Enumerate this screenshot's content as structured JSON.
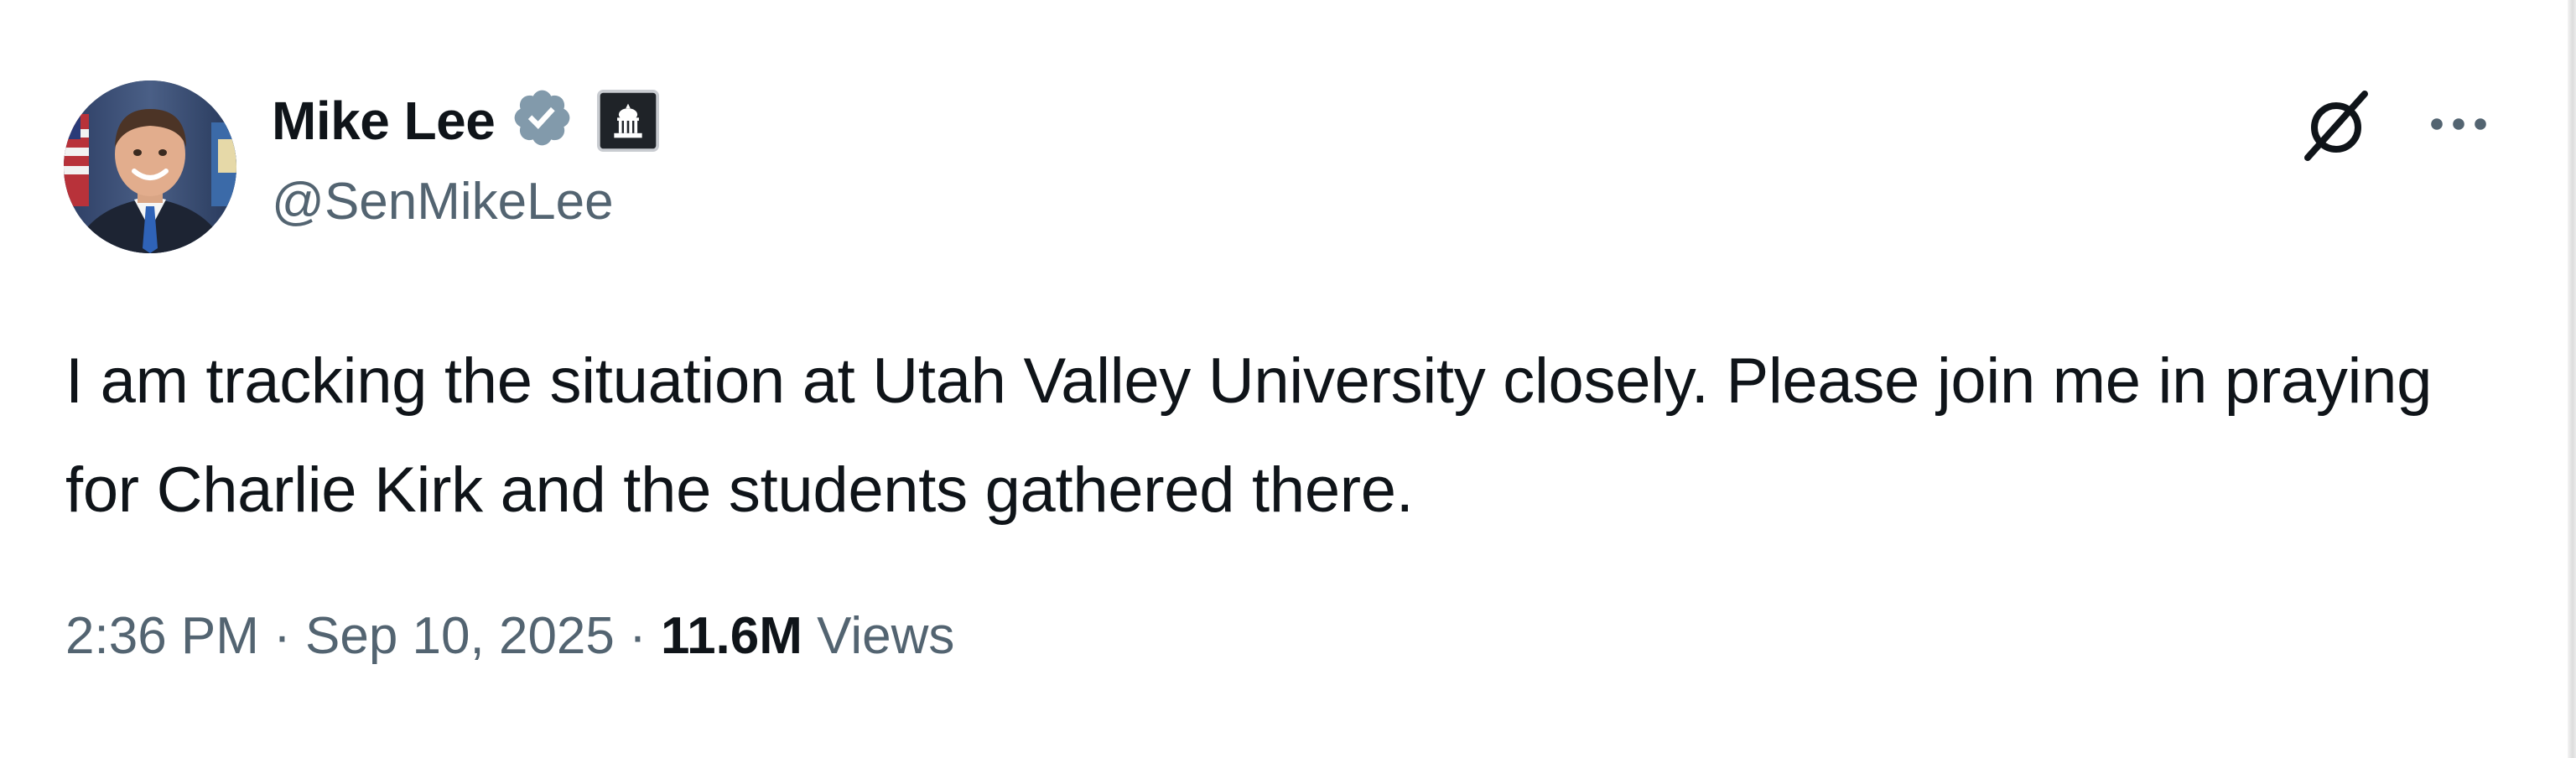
{
  "author": {
    "name": "Mike Lee",
    "handle": "@SenMikeLee",
    "verified_icon": "verified-badge-icon",
    "affiliation_icon": "government-capitol-icon",
    "avatar_icon": "profile-photo"
  },
  "tweet": {
    "text": "I am tracking the situation at Utah Valley University closely. Please join me in praying for Charlie Kirk and the students gathered there."
  },
  "meta": {
    "time": "2:36 PM",
    "separator": " · ",
    "date": "Sep 10, 2025",
    "views_count": "11.6M",
    "views_label": " Views"
  },
  "actions": {
    "grok_icon": "grok-icon",
    "more_icon": "more-options-icon"
  },
  "colors": {
    "text_primary": "#0f1419",
    "text_secondary": "#536471",
    "verified_badge": "#829aab"
  }
}
